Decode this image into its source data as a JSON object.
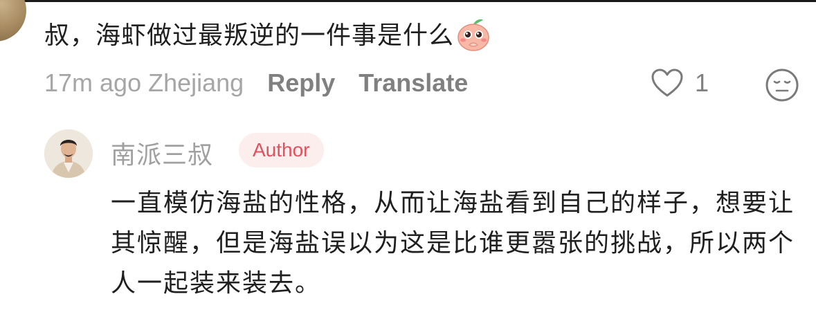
{
  "comment": {
    "text": "叔，海虾做过最叛逆的一件事是什么",
    "sticker_icon": "peach-emoji-icon",
    "time_location": "17m ago Zhejiang",
    "reply_label": "Reply",
    "translate_label": "Translate",
    "like_count": "1"
  },
  "reply": {
    "author_name": "南派三叔",
    "badge": "Author",
    "text": "一直模仿海盐的性格，从而让海盐看到自己的样子，想要让其惊醒，但是海盐误以为这是比谁更嚣张的挑战，所以两个人一起装来装去。"
  },
  "colors": {
    "text": "#1f1f1f",
    "meta": "#a6a6a6",
    "badge_text": "#e0515f",
    "badge_bg": "#fdeeee"
  }
}
